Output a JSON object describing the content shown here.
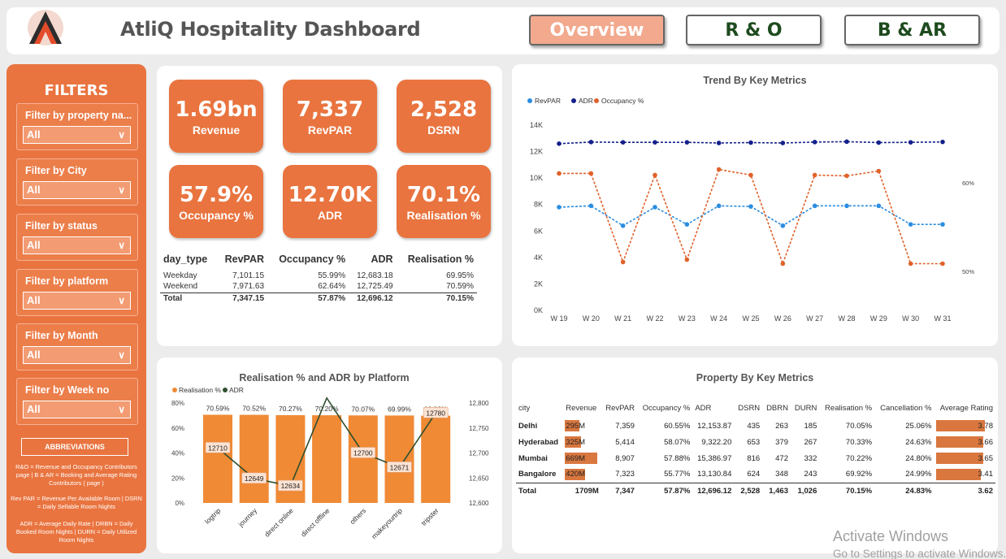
{
  "header": {
    "title": "AtliQ Hospitality Dashboard",
    "nav": [
      {
        "label": "Overview",
        "active": true
      },
      {
        "label": "R & O",
        "active": false
      },
      {
        "label": "B & AR",
        "active": false
      }
    ]
  },
  "filters": {
    "title": "FILTERS",
    "items": [
      {
        "label": "Filter by property na...",
        "value": "All"
      },
      {
        "label": "Filter by City",
        "value": "All"
      },
      {
        "label": "Filter by status",
        "value": "All"
      },
      {
        "label": "Filter by platform",
        "value": "All"
      },
      {
        "label": "Filter by Month",
        "value": "All"
      },
      {
        "label": "Filter by Week no",
        "value": "All"
      }
    ],
    "abbr_button": "ABBREVIATIONS",
    "abbr_lines": [
      "R&O = Revenue and Occupancy Contributors page | B & AR = Booking and Average Rating Contributors ( page )",
      "Rev PAR = Revenue Per Available Room | DSRN = Daily Sellable Room Nights",
      "ADR = Average Daily Rate  |  DRBN = Daily Booked Room Nights  |  DURN = Daily Utilized Room Nights"
    ]
  },
  "kpis": [
    {
      "value": "1.69bn",
      "label": "Revenue"
    },
    {
      "value": "7,337",
      "label": "RevPAR"
    },
    {
      "value": "2,528",
      "label": "DSRN"
    },
    {
      "value": "57.9%",
      "label": "Occupancy %"
    },
    {
      "value": "12.70K",
      "label": "ADR"
    },
    {
      "value": "70.1%",
      "label": "Realisation %"
    }
  ],
  "day_table": {
    "headers": [
      "day_type",
      "RevPAR",
      "Occupancy %",
      "ADR",
      "Realisation %"
    ],
    "rows": [
      [
        "Weekday",
        "7,101.15",
        "55.99%",
        "12,683.18",
        "69.95%"
      ],
      [
        "Weekend",
        "7,971.63",
        "62.64%",
        "12,725.49",
        "70.59%"
      ]
    ],
    "total": [
      "Total",
      "7,347.15",
      "57.87%",
      "12,696.12",
      "70.15%"
    ]
  },
  "trend": {
    "title": "Trend By Key Metrics",
    "legend": [
      "RevPAR",
      "ADR",
      "Occupancy %"
    ],
    "right_ticks": [
      "60%",
      "50%"
    ],
    "colors": {
      "revpar": "#2b8de0",
      "adr": "#14208a",
      "occ": "#e0622a"
    }
  },
  "platform": {
    "title": "Realisation % and ADR by Platform",
    "legend": [
      "Realisation %",
      "ADR"
    ],
    "colors": {
      "bar": "#f08a35",
      "line": "#2f4f2f"
    }
  },
  "property": {
    "title": "Property By Key Metrics",
    "headers": [
      "city",
      "Revenue",
      "RevPAR",
      "Occupancy %",
      "ADR",
      "DSRN",
      "DBRN",
      "DURN",
      "Realisation %",
      "Cancellation %",
      "Average Rating"
    ],
    "rows": [
      {
        "city": "Delhi",
        "revenue": "295M",
        "revenue_frac": 0.44,
        "revpar": "7,359",
        "occ": "60.55%",
        "adr": "12,153.87",
        "dsrn": "435",
        "dbrn": "263",
        "durn": "185",
        "real": "70.05%",
        "canc": "25.06%",
        "rating": "3.78",
        "rating_frac": 0.95
      },
      {
        "city": "Hyderabad",
        "revenue": "325M",
        "revenue_frac": 0.49,
        "revpar": "5,414",
        "occ": "58.07%",
        "adr": "9,322.20",
        "dsrn": "653",
        "dbrn": "379",
        "durn": "267",
        "real": "70.33%",
        "canc": "24.63%",
        "rating": "3.66",
        "rating_frac": 0.92
      },
      {
        "city": "Mumbai",
        "revenue": "669M",
        "revenue_frac": 1.0,
        "revpar": "8,907",
        "occ": "57.88%",
        "adr": "15,386.97",
        "dsrn": "816",
        "dbrn": "472",
        "durn": "332",
        "real": "70.22%",
        "canc": "24.80%",
        "rating": "3.65",
        "rating_frac": 0.92
      },
      {
        "city": "Bangalore",
        "revenue": "420M",
        "revenue_frac": 0.63,
        "revpar": "7,323",
        "occ": "55.77%",
        "adr": "13,130.84",
        "dsrn": "624",
        "dbrn": "348",
        "durn": "243",
        "real": "69.92%",
        "canc": "24.99%",
        "rating": "3.41",
        "rating_frac": 0.86
      }
    ],
    "total": {
      "city": "Total",
      "revenue": "1709M",
      "revpar": "7,347",
      "occ": "57.87%",
      "adr": "12,696.12",
      "dsrn": "2,528",
      "dbrn": "1,463",
      "durn": "1,026",
      "real": "70.15%",
      "canc": "24.83%",
      "rating": "3.62"
    }
  },
  "watermark": {
    "line1": "Activate Windows",
    "line2": "Go to Settings to activate Windows."
  },
  "chart_data": [
    {
      "type": "line",
      "title": "Trend By Key Metrics",
      "x": [
        "W 19",
        "W 20",
        "W 21",
        "W 22",
        "W 23",
        "W 24",
        "W 25",
        "W 26",
        "W 27",
        "W 28",
        "W 29",
        "W 30",
        "W 31"
      ],
      "ylim": [
        0,
        14000
      ],
      "yticks": [
        "0K",
        "2K",
        "4K",
        "6K",
        "8K",
        "10K",
        "12K",
        "14K"
      ],
      "series": [
        {
          "name": "RevPAR",
          "values": [
            7800,
            7900,
            6400,
            7800,
            6500,
            7900,
            7850,
            6400,
            7900,
            7900,
            7900,
            6500,
            6500
          ]
        },
        {
          "name": "ADR",
          "values": [
            12600,
            12720,
            12700,
            12700,
            12700,
            12650,
            12680,
            12650,
            12720,
            12750,
            12680,
            12700,
            12730
          ]
        },
        {
          "name": "Occupancy %",
          "axis": "right",
          "values": [
            63.0,
            63.0,
            52.0,
            62.8,
            52.3,
            63.5,
            62.8,
            51.8,
            62.8,
            62.7,
            63.3,
            51.8,
            51.8
          ],
          "ylim": [
            46,
            69
          ]
        }
      ]
    },
    {
      "type": "bar",
      "title": "Realisation % and ADR by Platform",
      "categories": [
        "logtrip",
        "journey",
        "direct online",
        "direct offline",
        "others",
        "makeyourtrip",
        "tripster"
      ],
      "ylim": [
        0,
        80
      ],
      "yticks": [
        "0%",
        "20%",
        "40%",
        "60%",
        "80%"
      ],
      "y2ticks": [
        "12,600",
        "12,650",
        "12,700",
        "12,750",
        "12,800"
      ],
      "series": [
        {
          "name": "Realisation %",
          "values": [
            70.59,
            70.52,
            70.27,
            70.2,
            70.07,
            69.99,
            69.83
          ],
          "labels": [
            "70.59%",
            "70.52%",
            "70.27%",
            "70.20%",
            "70.07%",
            "69.99%",
            "69.83%"
          ]
        },
        {
          "name": "ADR",
          "axis": "right",
          "values": [
            12710,
            12649,
            12634,
            12810,
            12700,
            12671,
            12780
          ],
          "ylim": [
            12600,
            12800
          ]
        }
      ]
    }
  ]
}
